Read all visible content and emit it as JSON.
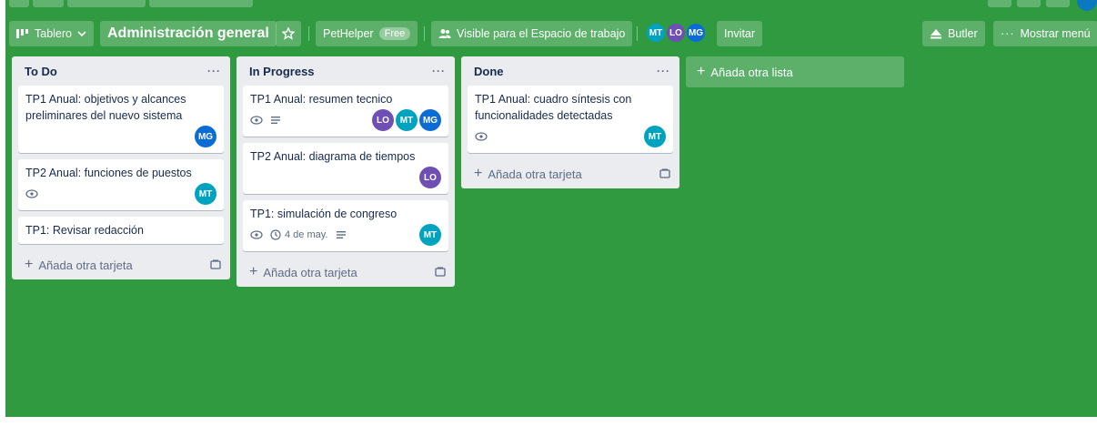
{
  "header": {
    "view_label": "Tablero",
    "board_title": "Administración general",
    "workspace_name": "PetHelper",
    "plan_badge": "Free",
    "visibility_label": "Visible para el Espacio de trabajo",
    "members": [
      {
        "initials": "MT",
        "color": "#00a3bf"
      },
      {
        "initials": "LO",
        "color": "#6e4fb3"
      },
      {
        "initials": "MG",
        "color": "#0a6cd4"
      }
    ],
    "invite_label": "Invitar",
    "butler_label": "Butler",
    "show_menu_label": "Mostrar menú"
  },
  "colors": {
    "board_bg": "#2f9a40",
    "avatar_mt": "#00a3bf",
    "avatar_lo": "#6e4fb3",
    "avatar_mg": "#0a6cd4"
  },
  "lists": [
    {
      "title": "To Do",
      "cards": [
        {
          "title": "TP1 Anual: objetivos y alcances preliminares del nuevo sistema",
          "members": [
            "MG"
          ]
        },
        {
          "title": "TP2 Anual: funciones de puestos",
          "members": [
            "MT"
          ],
          "watch": true
        },
        {
          "title": "TP1: Revisar redacción"
        }
      ],
      "add_card_label": "Añada otra tarjeta"
    },
    {
      "title": "In Progress",
      "cards": [
        {
          "title": "TP1 Anual: resumen tecnico",
          "members": [
            "LO",
            "MT",
            "MG"
          ],
          "watch": true,
          "description": true
        },
        {
          "title": "TP2 Anual: diagrama de tiempos",
          "members": [
            "LO"
          ]
        },
        {
          "title": "TP1: simulación de congreso",
          "members": [
            "MT"
          ],
          "watch": true,
          "due": "4 de may.",
          "description": true
        }
      ],
      "add_card_label": "Añada otra tarjeta"
    },
    {
      "title": "Done",
      "cards": [
        {
          "title": "TP1 Anual: cuadro síntesis con funcionalidades detectadas",
          "members": [
            "MT"
          ],
          "watch": true
        }
      ],
      "add_card_label": "Añada otra tarjeta"
    }
  ],
  "add_list_label": "Añada otra lista"
}
